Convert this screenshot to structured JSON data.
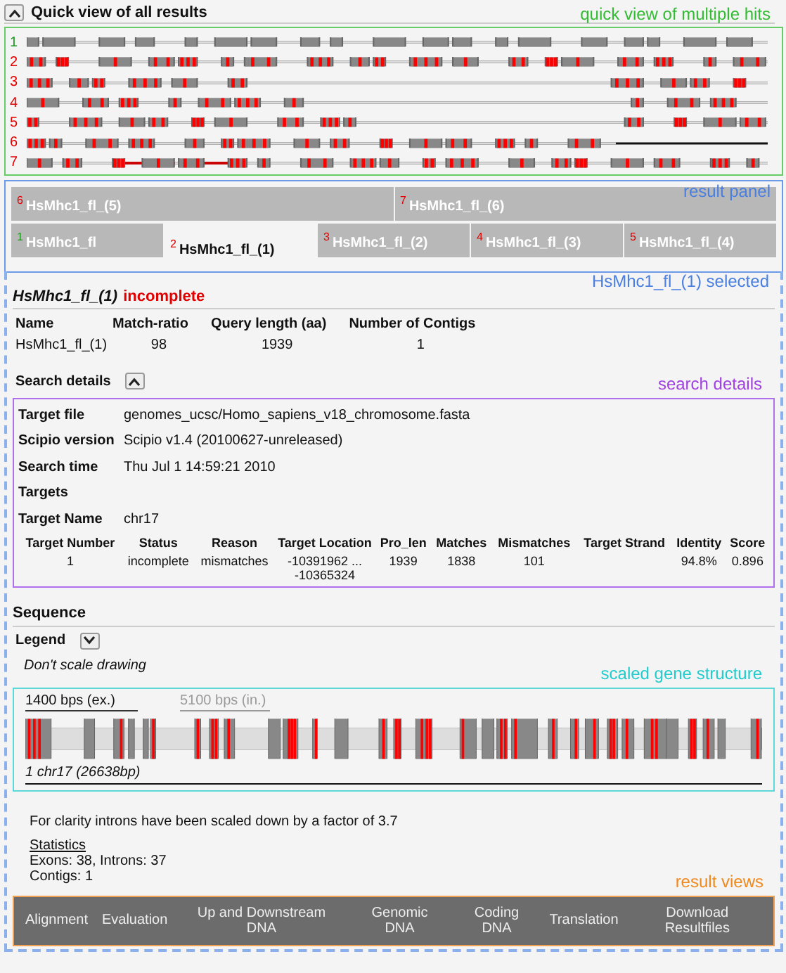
{
  "quick_view": {
    "title": "Quick view of all results",
    "expanded": true,
    "annotation": "quick view of multiple hits",
    "hits": [
      {
        "number": "1",
        "complete": true
      },
      {
        "number": "2",
        "complete": false
      },
      {
        "number": "3",
        "complete": false
      },
      {
        "number": "4",
        "complete": false
      },
      {
        "number": "5",
        "complete": false
      },
      {
        "number": "6",
        "complete": false
      },
      {
        "number": "7",
        "complete": false
      }
    ]
  },
  "result_panel": {
    "annotation": "result panel",
    "selection_annotation": "HsMhc1_fl_(1) selected",
    "tab_rows": [
      [
        {
          "number": "6",
          "label": "HsMhc1_fl_(5)",
          "complete": false,
          "selected": false
        },
        {
          "number": "7",
          "label": "HsMhc1_fl_(6)",
          "complete": false,
          "selected": false
        }
      ],
      [
        {
          "number": "1",
          "label": "HsMhc1_fl",
          "complete": true,
          "selected": false
        },
        {
          "number": "2",
          "label": "HsMhc1_fl_(1)",
          "complete": false,
          "selected": true
        },
        {
          "number": "3",
          "label": "HsMhc1_fl_(2)",
          "complete": false,
          "selected": false
        },
        {
          "number": "4",
          "label": "HsMhc1_fl_(3)",
          "complete": false,
          "selected": false
        },
        {
          "number": "5",
          "label": "HsMhc1_fl_(4)",
          "complete": false,
          "selected": false
        }
      ]
    ]
  },
  "result": {
    "name": "HsMhc1_fl_(1)",
    "status": "incomplete",
    "summary": {
      "columns": [
        "Name",
        "Match-ratio",
        "Query length (aa)",
        "Number of Contigs"
      ],
      "row": [
        "HsMhc1_fl_(1)",
        "98",
        "1939",
        "1"
      ]
    }
  },
  "search_details": {
    "title": "Search details",
    "expanded": true,
    "annotation": "search details",
    "fields": [
      {
        "label": "Target file",
        "value": "genomes_ucsc/Homo_sapiens_v18_chromosome.fasta"
      },
      {
        "label": "Scipio version",
        "value": "Scipio v1.4 (20100627-unreleased)"
      },
      {
        "label": "Search time",
        "value": "Thu Jul 1 14:59:21 2010"
      },
      {
        "label": "Targets"
      },
      {
        "label": "Target Name",
        "value": "chr17"
      }
    ],
    "targets_table": {
      "columns": [
        "Target Number",
        "Status",
        "Reason",
        "Target Location",
        "Pro_len",
        "Matches",
        "Mismatches",
        "Target Strand",
        "Identity",
        "Score"
      ],
      "rows": [
        [
          "1",
          "incomplete",
          "mismatches",
          "-10391962 ... -10365324",
          "1939",
          "1838",
          "101",
          "",
          "94.8%",
          "0.896"
        ]
      ]
    }
  },
  "sequence": {
    "title": "Sequence",
    "legend": {
      "label": "Legend",
      "expanded": false
    },
    "scale_note": "Don't scale drawing",
    "annotation": "scaled gene structure",
    "exon_scale": "1400 bps (ex.)",
    "intron_scale": "5100 bps (in.)",
    "contig_label": "1 chr17 (26638bp)",
    "note": "For clarity introns have been scaled down by a factor of 3.7",
    "statistics": {
      "title": "Statistics",
      "lines": [
        "Exons: 38, Introns: 37",
        "Contigs: 1"
      ]
    }
  },
  "result_views": {
    "annotation": "result views",
    "items": [
      "Alignment",
      "Evaluation",
      "Up and Downstream DNA",
      "Genomic DNA",
      "Coding DNA",
      "Translation",
      "Download Resultfiles"
    ]
  }
}
